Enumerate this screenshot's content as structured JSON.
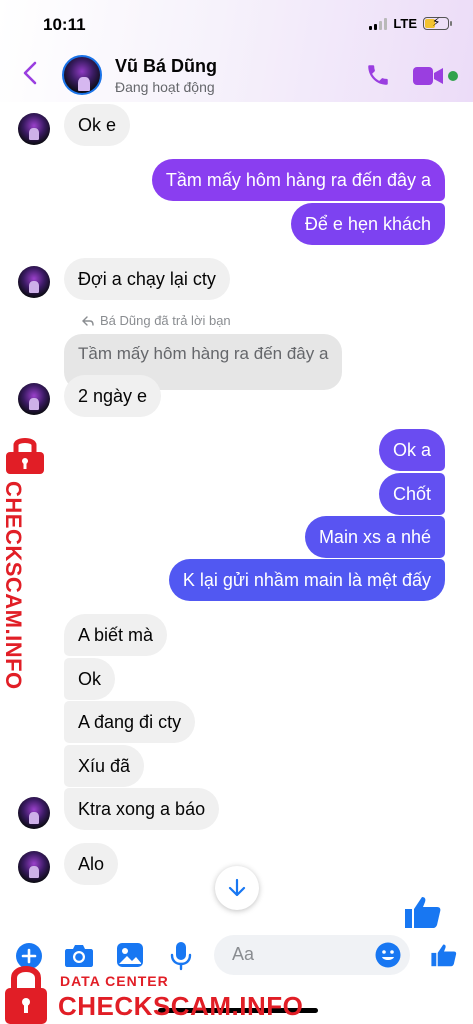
{
  "status_bar": {
    "time": "10:11",
    "network": "LTE"
  },
  "header": {
    "contact_name": "Vũ Bá Dũng",
    "contact_status": "Đang hoạt động"
  },
  "messages": [
    {
      "side": "in",
      "text": "Ok e"
    },
    {
      "side": "out",
      "text": "Tầm mấy hôm hàng ra đến đây a"
    },
    {
      "side": "out",
      "text": "Để e hẹn khách"
    },
    {
      "side": "in",
      "text": "Đợi a chạy lại cty"
    },
    {
      "side": "in",
      "text": "2 ngày e"
    },
    {
      "side": "out",
      "text": "Ok a"
    },
    {
      "side": "out",
      "text": "Chốt"
    },
    {
      "side": "out",
      "text": "Main xs a nhé"
    },
    {
      "side": "out",
      "text": "K lại gửi nhầm main là mệt đấy"
    },
    {
      "side": "in",
      "text": "A biết mà"
    },
    {
      "side": "in",
      "text": "Ok"
    },
    {
      "side": "in",
      "text": "A đang đi cty"
    },
    {
      "side": "in",
      "text": "Xíu đã"
    },
    {
      "side": "in",
      "text": "Ktra xong a báo"
    },
    {
      "side": "in",
      "text": "Alo"
    }
  ],
  "reply": {
    "note": "Bá Dũng đã trả lời bạn",
    "quoted_text": "Tầm mấy hôm hàng ra đến đây a"
  },
  "composer": {
    "placeholder": "Aa"
  },
  "watermark": {
    "label": "DATA CENTER",
    "brand": "CHECKSCAM.INFO"
  },
  "colors": {
    "accent": "#9a3ee0",
    "bubble_out_top": "#8a3ef0",
    "bubble_out_bottom": "#4f5cf2",
    "bubble_in": "#f0f0f0",
    "composer_icons": "#1877f2",
    "watermark": "#e11e26"
  },
  "icons": [
    "back-arrow-icon",
    "phone-icon",
    "video-camera-icon",
    "plus-circle-icon",
    "camera-icon",
    "photo-icon",
    "microphone-icon",
    "emoji-icon",
    "thumbs-up-icon",
    "arrow-down-icon",
    "reply-arrow-icon",
    "lock-icon"
  ]
}
